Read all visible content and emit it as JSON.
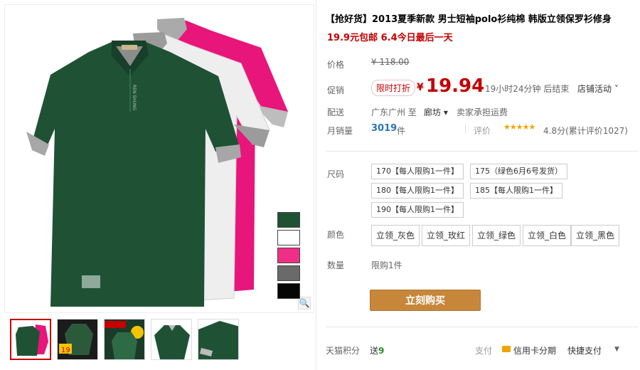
{
  "product": {
    "title": "【抢好货】2013夏季新款 男士短袖polo衫纯棉 韩版立领保罗衫修身",
    "subtitle": "19.9元包邮 6.4今日最后一天"
  },
  "labels": {
    "price": "价格",
    "promo": "促销",
    "delivery": "配送",
    "monthly_sales": "月销量",
    "size": "尺码",
    "color": "颜色",
    "quantity": "数量",
    "tmall_points": "天猫积分",
    "payment": "支付",
    "rating": "评价"
  },
  "pricing": {
    "original": "¥ 118.00",
    "promo_tag": "限时打折",
    "currency": "¥",
    "current": "19.94",
    "countdown": "19小时24分钟 后结束",
    "activity": "店铺活动 ˅"
  },
  "shipping": {
    "from": "广东广州 至",
    "to": "廊坊 ▾",
    "fee": "卖家承担运费"
  },
  "sales": {
    "count": "3019",
    "unit": "件",
    "stars": "★★★★★",
    "score_text": "4.8分(累计评价1027)"
  },
  "sizes": [
    "170【每人限购1一件】",
    "175（绿色6月6号发货）",
    "180【每人限购1一件】",
    "185【每人限购1一件】",
    "190【每人限购1一件】"
  ],
  "colors": [
    "立领_灰色",
    "立领_玫红",
    "立领_绿色",
    "立领_白色",
    "立领_黑色"
  ],
  "quantity_limit": "限购1件",
  "buy_button": "立刻购买",
  "footer": {
    "points_prefix": "送",
    "points_value": "9",
    "pay_credit": "信用卡分期",
    "pay_fast": "快捷支付"
  },
  "swatch_colors": [
    "#1f5235",
    "#ffffff",
    "#ef2f86",
    "#6a6a6a",
    "#050505"
  ],
  "brand_colors": {
    "shirt_green": "#1f5235",
    "shirt_pink": "#e8157a",
    "shirt_white": "#efefef",
    "accent_red": "#c40000",
    "buy_button": "#c6873b"
  }
}
